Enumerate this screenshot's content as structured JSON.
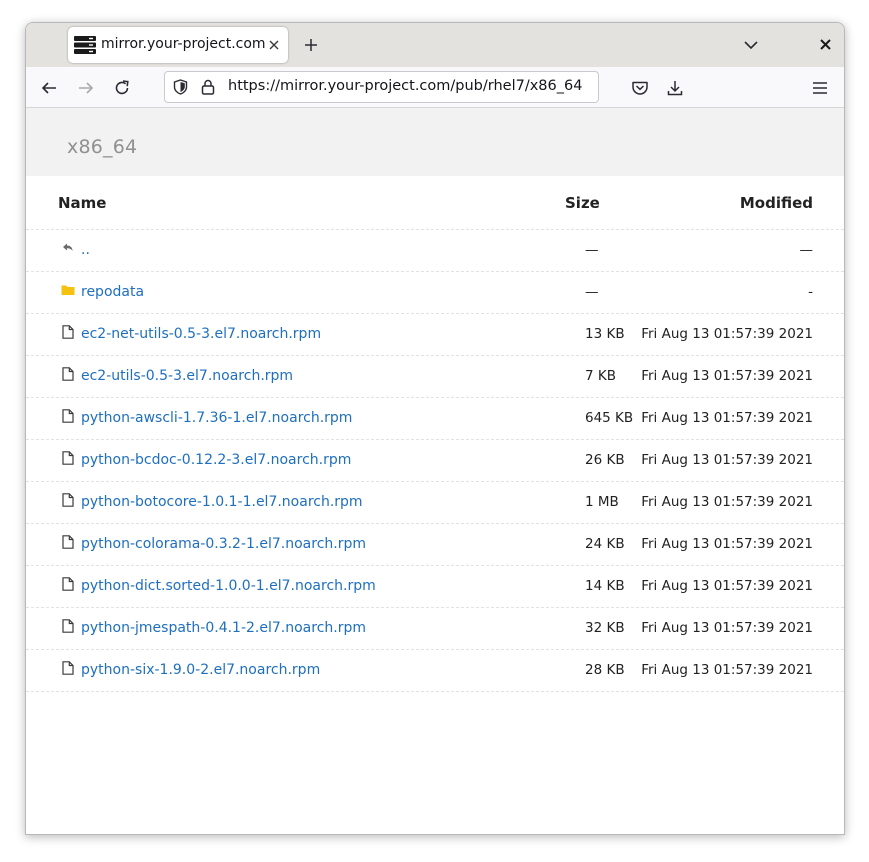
{
  "browser": {
    "tab_title": "mirror.your-project.com",
    "url": "https://mirror.your-project.com/pub/rhel7/x86_64"
  },
  "page": {
    "title": "x86_64",
    "columns": {
      "name": "Name",
      "size": "Size",
      "modified": "Modified"
    },
    "rows": [
      {
        "type": "parent",
        "icon": "go-up-icon",
        "name": "..",
        "size": "—",
        "modified": "—"
      },
      {
        "type": "folder",
        "icon": "folder-icon",
        "name": "repodata",
        "size": "—",
        "modified": "-"
      },
      {
        "type": "file",
        "icon": "file-icon",
        "name": "ec2-net-utils-0.5-3.el7.noarch.rpm",
        "size": "13 KB",
        "modified": "Fri Aug 13 01:57:39 2021"
      },
      {
        "type": "file",
        "icon": "file-icon",
        "name": "ec2-utils-0.5-3.el7.noarch.rpm",
        "size": "7 KB",
        "modified": "Fri Aug 13 01:57:39 2021"
      },
      {
        "type": "file",
        "icon": "file-icon",
        "name": "python-awscli-1.7.36-1.el7.noarch.rpm",
        "size": "645 KB",
        "modified": "Fri Aug 13 01:57:39 2021"
      },
      {
        "type": "file",
        "icon": "file-icon",
        "name": "python-bcdoc-0.12.2-3.el7.noarch.rpm",
        "size": "26 KB",
        "modified": "Fri Aug 13 01:57:39 2021"
      },
      {
        "type": "file",
        "icon": "file-icon",
        "name": "python-botocore-1.0.1-1.el7.noarch.rpm",
        "size": "1 MB",
        "modified": "Fri Aug 13 01:57:39 2021"
      },
      {
        "type": "file",
        "icon": "file-icon",
        "name": "python-colorama-0.3.2-1.el7.noarch.rpm",
        "size": "24 KB",
        "modified": "Fri Aug 13 01:57:39 2021"
      },
      {
        "type": "file",
        "icon": "file-icon",
        "name": "python-dict.sorted-1.0.0-1.el7.noarch.rpm",
        "size": "14 KB",
        "modified": "Fri Aug 13 01:57:39 2021"
      },
      {
        "type": "file",
        "icon": "file-icon",
        "name": "python-jmespath-0.4.1-2.el7.noarch.rpm",
        "size": "32 KB",
        "modified": "Fri Aug 13 01:57:39 2021"
      },
      {
        "type": "file",
        "icon": "file-icon",
        "name": "python-six-1.9.0-2.el7.noarch.rpm",
        "size": "28 KB",
        "modified": "Fri Aug 13 01:57:39 2021"
      }
    ]
  },
  "colors": {
    "link": "#1e6fbe",
    "folder": "#f5c211",
    "header_bg": "#f2f2f2",
    "title_text": "#909090"
  }
}
